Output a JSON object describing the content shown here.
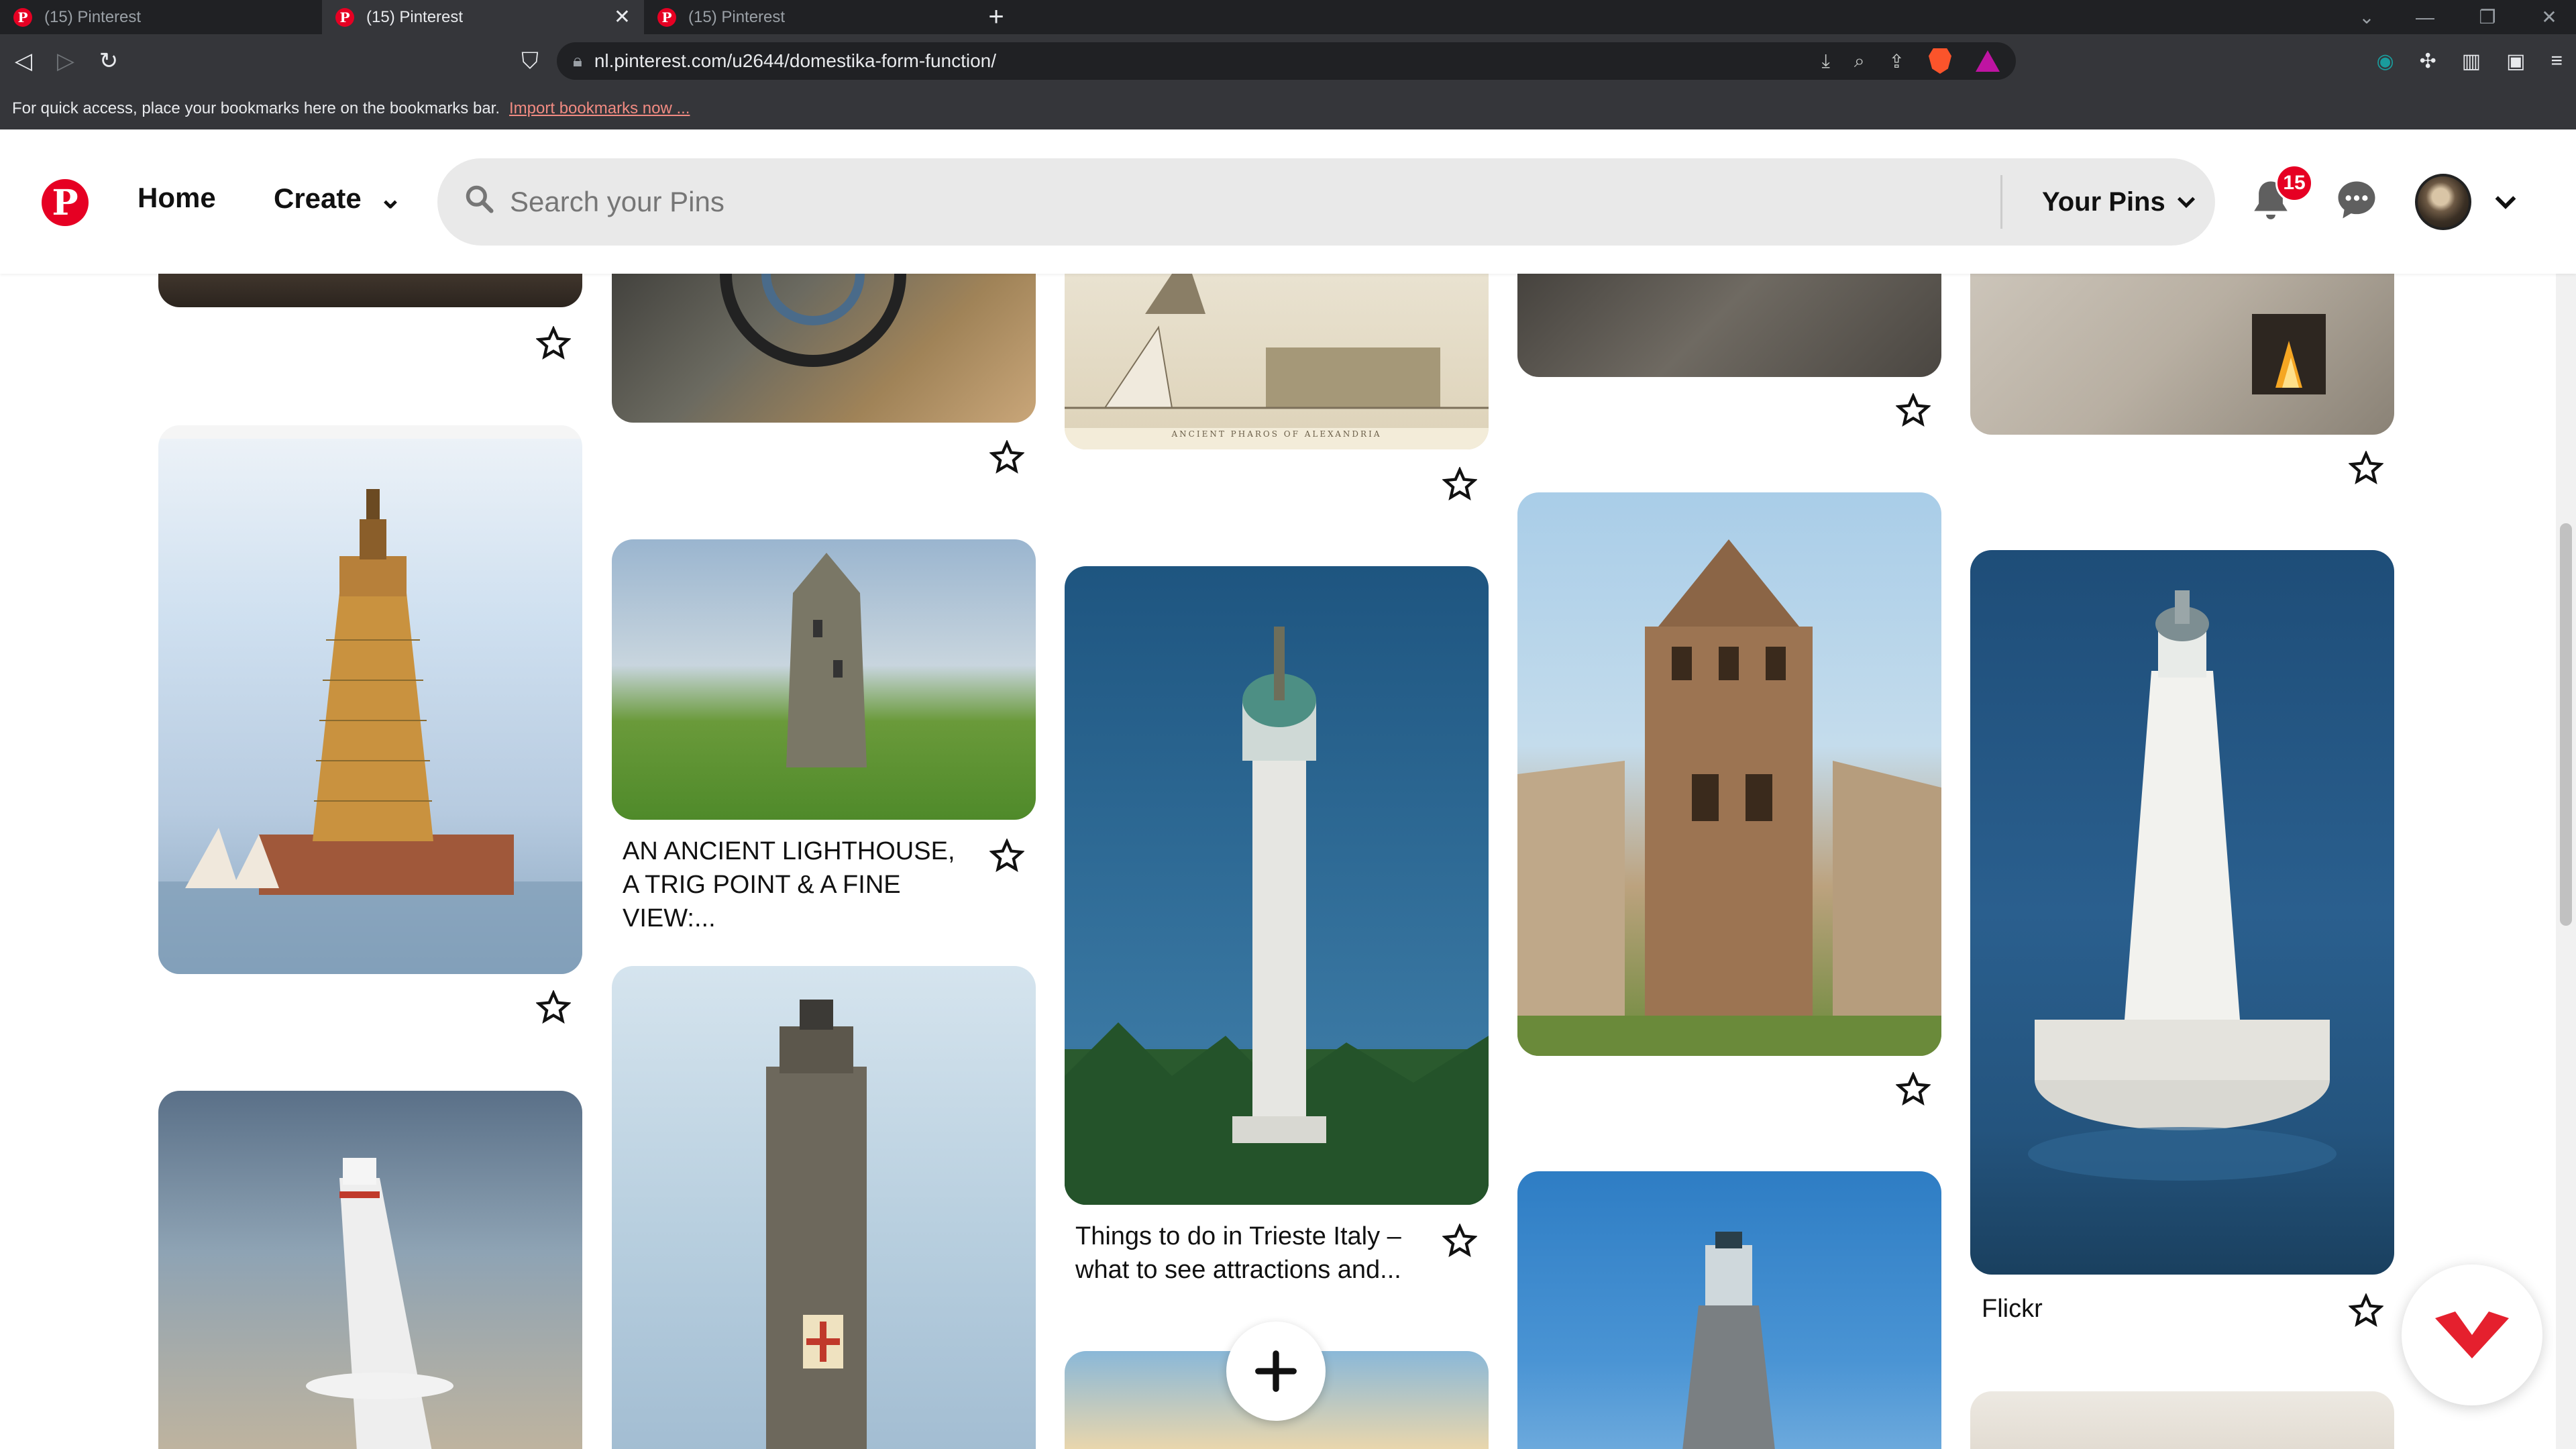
{
  "browser": {
    "tabs": [
      {
        "title": "(15) Pinterest"
      },
      {
        "title": "(15) Pinterest"
      },
      {
        "title": "(15) Pinterest"
      }
    ],
    "url": "nl.pinterest.com/u2644/domestika-form-function/",
    "bookmarks_hint": "For quick access, place your bookmarks here on the bookmarks bar.",
    "bookmarks_link": "Import bookmarks now ..."
  },
  "header": {
    "logo": "P",
    "home_label": "Home",
    "create_label": "Create",
    "search_placeholder": "Search your Pins",
    "your_pins_label": "Your Pins",
    "notification_count": "15"
  },
  "pins": {
    "lighthouse_caption": "AN ANCIENT LIGHTHOUSE, A TRIG POINT & A FINE VIEW:...",
    "trieste_caption": "Things to do in Trieste Italy – what to see attractions and...",
    "flickr_caption": "Flickr",
    "pharos_label": "ANCIENT PHAROS OF ALEXANDRIA"
  },
  "colors": {
    "pinterest_red": "#e60023",
    "chrome_dark": "#35363a"
  }
}
